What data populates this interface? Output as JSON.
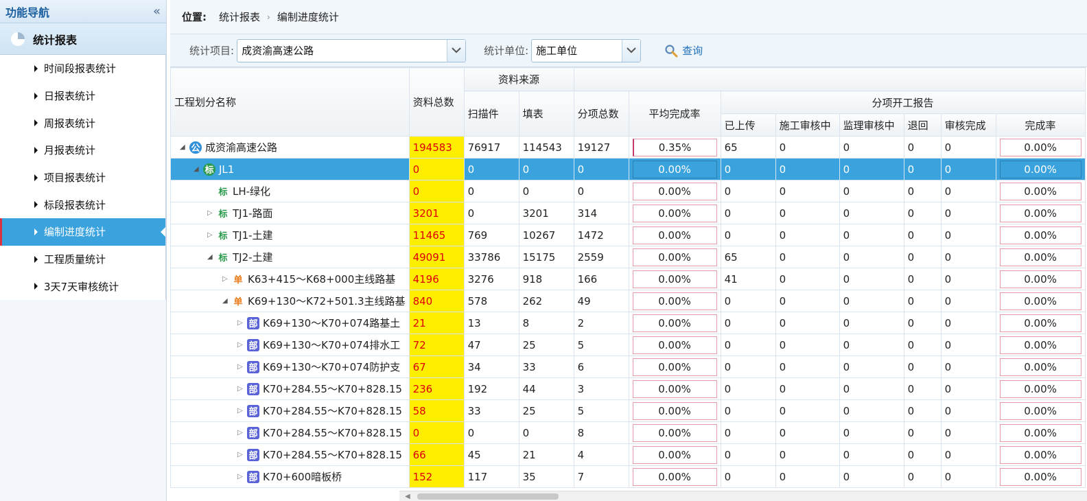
{
  "sidebar": {
    "title": "功能导航",
    "collapse": "«",
    "group": "统计报表",
    "items": [
      {
        "label": "时间段报表统计"
      },
      {
        "label": "日报表统计"
      },
      {
        "label": "周报表统计"
      },
      {
        "label": "月报表统计"
      },
      {
        "label": "项目报表统计"
      },
      {
        "label": "标段报表统计"
      },
      {
        "label": "编制进度统计"
      },
      {
        "label": "工程质量统计"
      },
      {
        "label": "3天7天审核统计"
      }
    ],
    "active_index": 6
  },
  "breadcrumb": {
    "label": "位置:",
    "parts": [
      "统计报表",
      "编制进度统计"
    ]
  },
  "filter": {
    "project_label": "统计项目:",
    "project_value": "成资渝高速公路",
    "unit_label": "统计单位:",
    "unit_value": "施工单位",
    "query_label": "查询"
  },
  "table": {
    "headers": {
      "name": "工程划分名称",
      "total": "资料总数",
      "source": "资料来源",
      "scan": "扫描件",
      "fill": "填表",
      "items": "分项总数",
      "avg_rate": "平均完成率",
      "report": "分项开工报告",
      "uploaded": "已上传",
      "construct_review": "施工审核中",
      "supervise_review": "监理审核中",
      "returned": "退回",
      "review_done": "审核完成",
      "rate": "完成率"
    },
    "rows": [
      {
        "level": 0,
        "tri": "◢",
        "badge": "公",
        "btype": "gong",
        "name": "成资渝高速公路",
        "total": "194583",
        "scan": "76917",
        "fill": "114543",
        "items": "19127",
        "avg": "0.35%",
        "up": "65",
        "c1": "0",
        "c2": "0",
        "c3": "0",
        "c4": "0",
        "rate": "0.00%"
      },
      {
        "level": 1,
        "tri": "◢",
        "badge": "标",
        "btype": "biao",
        "name": "JL1",
        "total": "0",
        "scan": "0",
        "fill": "0",
        "items": "0",
        "avg": "0.00%",
        "up": "0",
        "c1": "0",
        "c2": "0",
        "c3": "0",
        "c4": "0",
        "rate": "0.00%",
        "selected": true
      },
      {
        "level": 2,
        "tri": "",
        "badge": "标",
        "btype": "biao",
        "name": "LH-绿化",
        "total": "0",
        "scan": "0",
        "fill": "0",
        "items": "0",
        "avg": "0.00%",
        "up": "0",
        "c1": "0",
        "c2": "0",
        "c3": "0",
        "c4": "0",
        "rate": "0.00%"
      },
      {
        "level": 2,
        "tri": "▷",
        "badge": "标",
        "btype": "biao",
        "name": "TJ1-路面",
        "total": "3201",
        "scan": "0",
        "fill": "3201",
        "items": "314",
        "avg": "0.00%",
        "up": "0",
        "c1": "0",
        "c2": "0",
        "c3": "0",
        "c4": "0",
        "rate": "0.00%"
      },
      {
        "level": 2,
        "tri": "▷",
        "badge": "标",
        "btype": "biao",
        "name": "TJ1-土建",
        "total": "11465",
        "scan": "769",
        "fill": "10267",
        "items": "1472",
        "avg": "0.00%",
        "up": "0",
        "c1": "0",
        "c2": "0",
        "c3": "0",
        "c4": "0",
        "rate": "0.00%"
      },
      {
        "level": 2,
        "tri": "◢",
        "badge": "标",
        "btype": "biao",
        "name": "TJ2-土建",
        "total": "49091",
        "scan": "33786",
        "fill": "15175",
        "items": "2559",
        "avg": "0.00%",
        "up": "65",
        "c1": "0",
        "c2": "0",
        "c3": "0",
        "c4": "0",
        "rate": "0.00%"
      },
      {
        "level": 3,
        "tri": "▷",
        "badge": "单",
        "btype": "dan",
        "name": "K63+415～K68+000主线路基",
        "total": "4196",
        "scan": "3276",
        "fill": "918",
        "items": "166",
        "avg": "0.00%",
        "up": "41",
        "c1": "0",
        "c2": "0",
        "c3": "0",
        "c4": "0",
        "rate": "0.00%"
      },
      {
        "level": 3,
        "tri": "◢",
        "badge": "单",
        "btype": "dan",
        "name": "K69+130～K72+501.3主线路基",
        "total": "840",
        "scan": "578",
        "fill": "262",
        "items": "49",
        "avg": "0.00%",
        "up": "0",
        "c1": "0",
        "c2": "0",
        "c3": "0",
        "c4": "0",
        "rate": "0.00%"
      },
      {
        "level": 4,
        "tri": "▷",
        "badge": "部",
        "btype": "bu",
        "name": "K69+130～K70+074路基土",
        "total": "21",
        "scan": "13",
        "fill": "8",
        "items": "2",
        "avg": "0.00%",
        "up": "0",
        "c1": "0",
        "c2": "0",
        "c3": "0",
        "c4": "0",
        "rate": "0.00%"
      },
      {
        "level": 4,
        "tri": "▷",
        "badge": "部",
        "btype": "bu",
        "name": "K69+130～K70+074排水工",
        "total": "72",
        "scan": "47",
        "fill": "25",
        "items": "5",
        "avg": "0.00%",
        "up": "0",
        "c1": "0",
        "c2": "0",
        "c3": "0",
        "c4": "0",
        "rate": "0.00%"
      },
      {
        "level": 4,
        "tri": "▷",
        "badge": "部",
        "btype": "bu",
        "name": "K69+130～K70+074防护支",
        "total": "67",
        "scan": "34",
        "fill": "33",
        "items": "6",
        "avg": "0.00%",
        "up": "0",
        "c1": "0",
        "c2": "0",
        "c3": "0",
        "c4": "0",
        "rate": "0.00%"
      },
      {
        "level": 4,
        "tri": "▷",
        "badge": "部",
        "btype": "bu",
        "name": "K70+284.55～K70+828.15",
        "total": "236",
        "scan": "192",
        "fill": "44",
        "items": "3",
        "avg": "0.00%",
        "up": "0",
        "c1": "0",
        "c2": "0",
        "c3": "0",
        "c4": "0",
        "rate": "0.00%"
      },
      {
        "level": 4,
        "tri": "▷",
        "badge": "部",
        "btype": "bu",
        "name": "K70+284.55～K70+828.15",
        "total": "58",
        "scan": "33",
        "fill": "25",
        "items": "5",
        "avg": "0.00%",
        "up": "0",
        "c1": "0",
        "c2": "0",
        "c3": "0",
        "c4": "0",
        "rate": "0.00%"
      },
      {
        "level": 4,
        "tri": "▷",
        "badge": "部",
        "btype": "bu",
        "name": "K70+284.55～K70+828.15",
        "total": "0",
        "scan": "0",
        "fill": "0",
        "items": "8",
        "avg": "0.00%",
        "up": "0",
        "c1": "0",
        "c2": "0",
        "c3": "0",
        "c4": "0",
        "rate": "0.00%"
      },
      {
        "level": 4,
        "tri": "▷",
        "badge": "部",
        "btype": "bu",
        "name": "K70+284.55～K70+828.15",
        "total": "66",
        "scan": "45",
        "fill": "21",
        "items": "4",
        "avg": "0.00%",
        "up": "0",
        "c1": "0",
        "c2": "0",
        "c3": "0",
        "c4": "0",
        "rate": "0.00%"
      },
      {
        "level": 4,
        "tri": "▷",
        "badge": "部",
        "btype": "bu",
        "name": "K70+600暗板桥",
        "total": "152",
        "scan": "117",
        "fill": "35",
        "items": "7",
        "avg": "0.00%",
        "up": "0",
        "c1": "0",
        "c2": "0",
        "c3": "0",
        "c4": "0",
        "rate": "0.00%"
      }
    ]
  },
  "colors": {
    "accent": "#3aa2dd",
    "total_bg": "#ffee00",
    "total_text": "#e00000"
  }
}
